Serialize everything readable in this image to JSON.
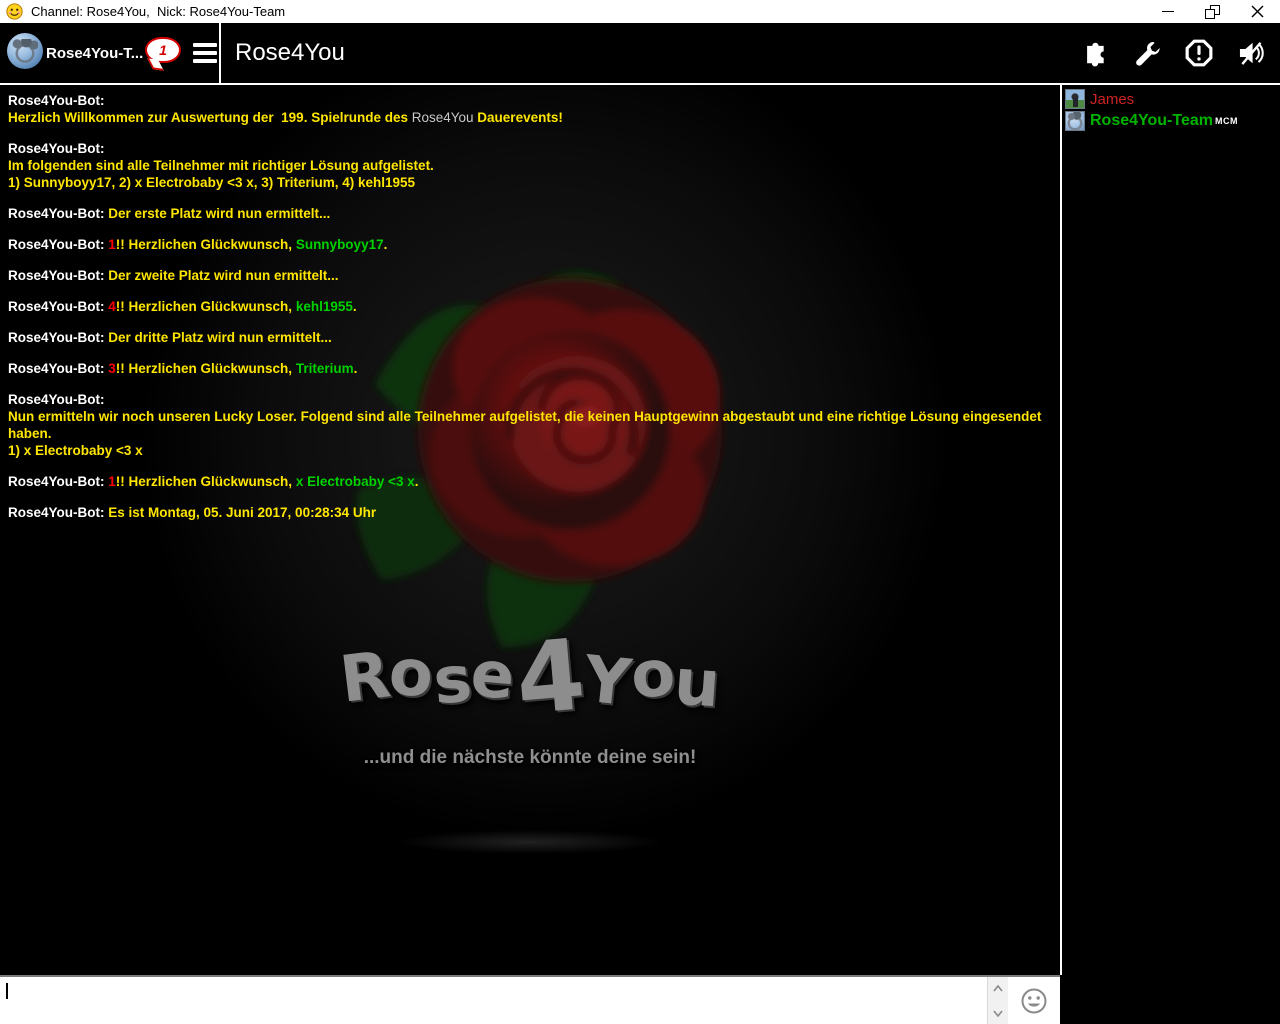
{
  "window": {
    "title": "Channel: Rose4You,  Nick: Rose4You-Team"
  },
  "header": {
    "channel_name": "Rose4You-T...",
    "badge_count": "1",
    "title": "Rose4You",
    "icons": [
      "plugins-icon",
      "settings-icon",
      "alert-icon",
      "sound-muted-icon"
    ]
  },
  "chat": {
    "messages": [
      {
        "lines": [
          [
            {
              "c": "name",
              "t": "Rose4You-Bot:"
            }
          ],
          [
            {
              "c": "y",
              "t": "Herzlich Willkommen zur Auswertung der  199. Spielrunde des "
            },
            {
              "c": "w",
              "t": "Rose4You"
            },
            {
              "c": "y",
              "t": " Dauerevents!"
            }
          ]
        ]
      },
      {
        "lines": [
          [
            {
              "c": "name",
              "t": "Rose4You-Bot:"
            }
          ],
          [
            {
              "c": "y",
              "t": "Im folgenden sind alle Teilnehmer mit richtiger Lösung aufgelistet."
            }
          ],
          [
            {
              "c": "y",
              "t": "1) Sunnyboyy17, 2) x Electrobaby <3 x, 3) Triterium, 4) kehl1955"
            }
          ]
        ]
      },
      {
        "lines": [
          [
            {
              "c": "name",
              "t": "Rose4You-Bot: "
            },
            {
              "c": "y",
              "t": "Der erste Platz wird nun ermittelt..."
            }
          ]
        ]
      },
      {
        "lines": [
          [
            {
              "c": "name",
              "t": "Rose4You-Bot: "
            },
            {
              "c": "r",
              "t": "1"
            },
            {
              "c": "y",
              "t": "!! Herzlichen Glückwunsch, "
            },
            {
              "c": "g",
              "t": "Sunnyboyy17"
            },
            {
              "c": "y",
              "t": "."
            }
          ]
        ]
      },
      {
        "lines": [
          [
            {
              "c": "name",
              "t": "Rose4You-Bot: "
            },
            {
              "c": "y",
              "t": "Der zweite Platz wird nun ermittelt..."
            }
          ]
        ]
      },
      {
        "lines": [
          [
            {
              "c": "name",
              "t": "Rose4You-Bot: "
            },
            {
              "c": "r",
              "t": "4"
            },
            {
              "c": "y",
              "t": "!! Herzlichen Glückwunsch, "
            },
            {
              "c": "g",
              "t": "kehl1955"
            },
            {
              "c": "y",
              "t": "."
            }
          ]
        ]
      },
      {
        "lines": [
          [
            {
              "c": "name",
              "t": "Rose4You-Bot: "
            },
            {
              "c": "y",
              "t": "Der dritte Platz wird nun ermittelt..."
            }
          ]
        ]
      },
      {
        "lines": [
          [
            {
              "c": "name",
              "t": "Rose4You-Bot: "
            },
            {
              "c": "r",
              "t": "3"
            },
            {
              "c": "y",
              "t": "!! Herzlichen Glückwunsch, "
            },
            {
              "c": "g",
              "t": "Triterium"
            },
            {
              "c": "y",
              "t": "."
            }
          ]
        ]
      },
      {
        "lines": [
          [
            {
              "c": "name",
              "t": "Rose4You-Bot:"
            }
          ],
          [
            {
              "c": "y",
              "t": "Nun ermitteln wir noch unseren Lucky Loser. Folgend sind alle Teilnehmer aufgelistet, die keinen Hauptgewinn abgestaubt und eine richtige Lösung eingesendet haben."
            }
          ],
          [
            {
              "c": "y",
              "t": "1) x Electrobaby <3 x"
            }
          ]
        ]
      },
      {
        "lines": [
          [
            {
              "c": "name",
              "t": "Rose4You-Bot: "
            },
            {
              "c": "r",
              "t": "1"
            },
            {
              "c": "y",
              "t": "!! Herzlichen Glückwunsch, "
            },
            {
              "c": "g",
              "t": "x Electrobaby <3 x"
            },
            {
              "c": "y",
              "t": "."
            }
          ]
        ]
      },
      {
        "lines": [
          [
            {
              "c": "name",
              "t": "Rose4You-Bot: "
            },
            {
              "c": "y",
              "t": "Es ist Montag, 05. Juni 2017, 00:28:34 Uhr"
            }
          ]
        ]
      }
    ]
  },
  "sidebar": {
    "users": [
      {
        "name": "James",
        "style": "james",
        "badge": ""
      },
      {
        "name": "Rose4You-Team",
        "style": "team",
        "badge": "MCM"
      }
    ]
  },
  "watermark": {
    "logo": "Rose4You",
    "tagline": "...und die nächste könnte deine sein!"
  },
  "composer": {
    "value": "",
    "placeholder": ""
  },
  "colors": {
    "message_yellow": "#ffe600",
    "message_green": "#00d200",
    "message_red": "#ff0000",
    "message_white": "#ffffff",
    "inline_gray": "#c8c8c8",
    "user_james": "#cc2222",
    "user_team": "#00b400",
    "badge_red": "#d40000"
  }
}
